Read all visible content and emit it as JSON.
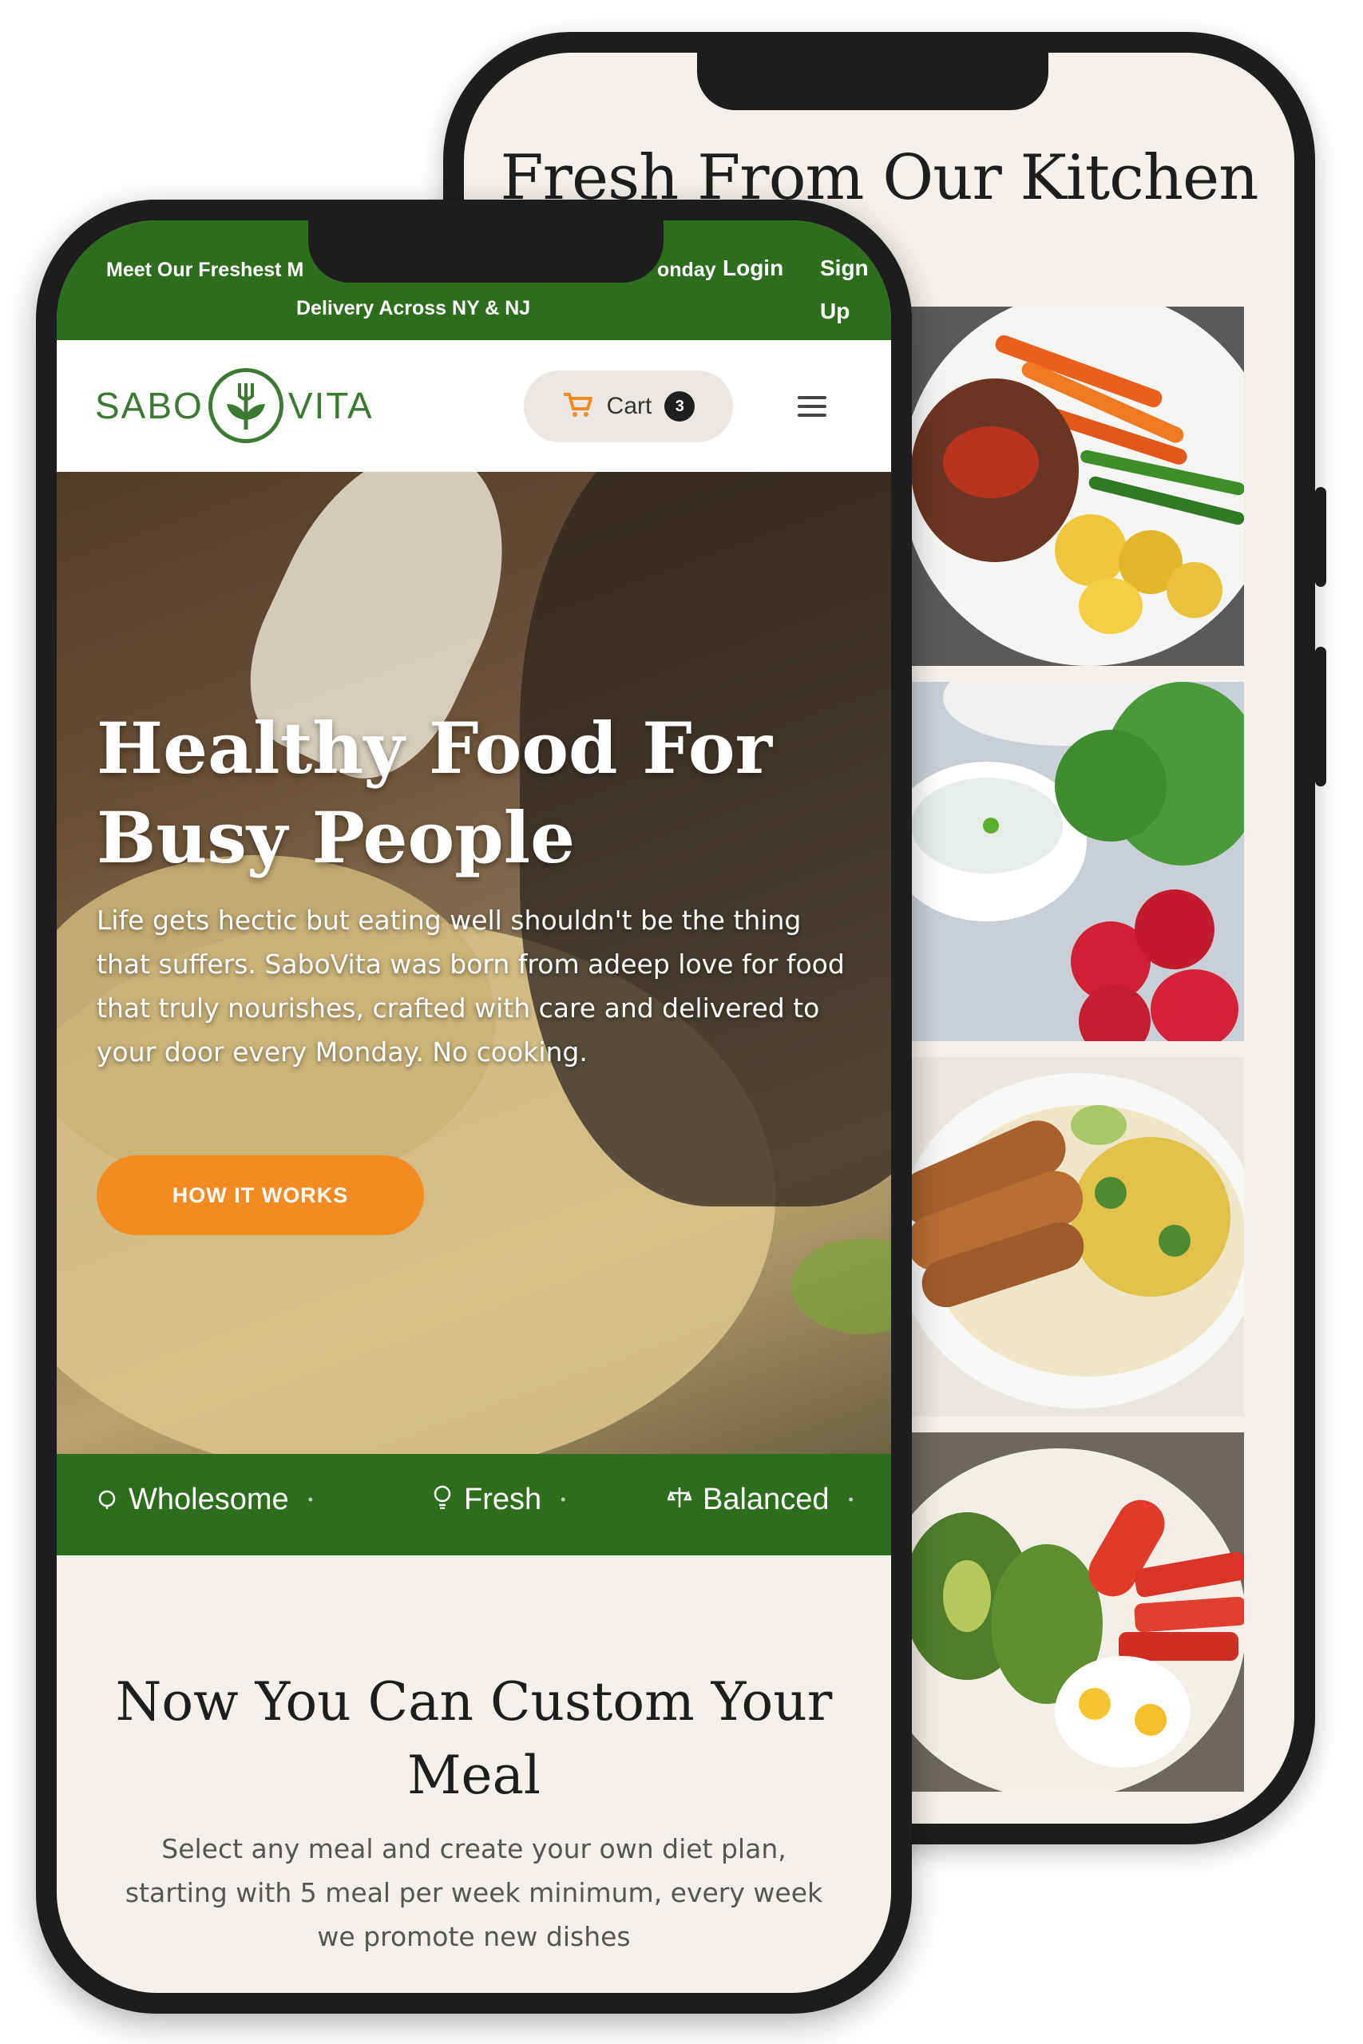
{
  "back_page": {
    "title": "Fresh From Our Kitchen",
    "images": [
      "steak-vegetable-plate",
      "yogurt-dip-radish",
      "grilled-chicken-corn-rice",
      "avocado-eggs-tomato"
    ]
  },
  "front_page": {
    "topbar": {
      "announcement_line1_left": "Meet Our Freshest M",
      "announcement_line1_right": "onday",
      "announcement_line2": "Delivery Across NY & NJ",
      "login": "Login",
      "signup_line1": "Sign",
      "signup_line2": "Up"
    },
    "header": {
      "logo_left": "SABO",
      "logo_right": "VITA",
      "cart_label": "Cart",
      "cart_count": "3"
    },
    "hero": {
      "title": "Healthy Food For Busy People",
      "text": "Life gets hectic but eating well shouldn't be the thing that suffers. SaboVita was born from adeep love for food that truly nourishes, crafted with care and delivered to your door every Monday. No cooking.",
      "button": "HOW IT WORKS"
    },
    "ticker": [
      {
        "label": "Wholesome",
        "icon": "leaf-icon"
      },
      {
        "label": "Fresh",
        "icon": "bulb-icon"
      },
      {
        "label": "Balanced",
        "icon": "balance-icon"
      }
    ],
    "custom": {
      "title": "Now You Can Custom Your Meal",
      "text": "Select any meal and create your own diet plan, starting with 5 meal per week minimum, every week we promote new dishes"
    }
  },
  "colors": {
    "brand_green": "#2c6e1c",
    "accent_orange": "#f38a22",
    "background": "#f4f1ec"
  }
}
